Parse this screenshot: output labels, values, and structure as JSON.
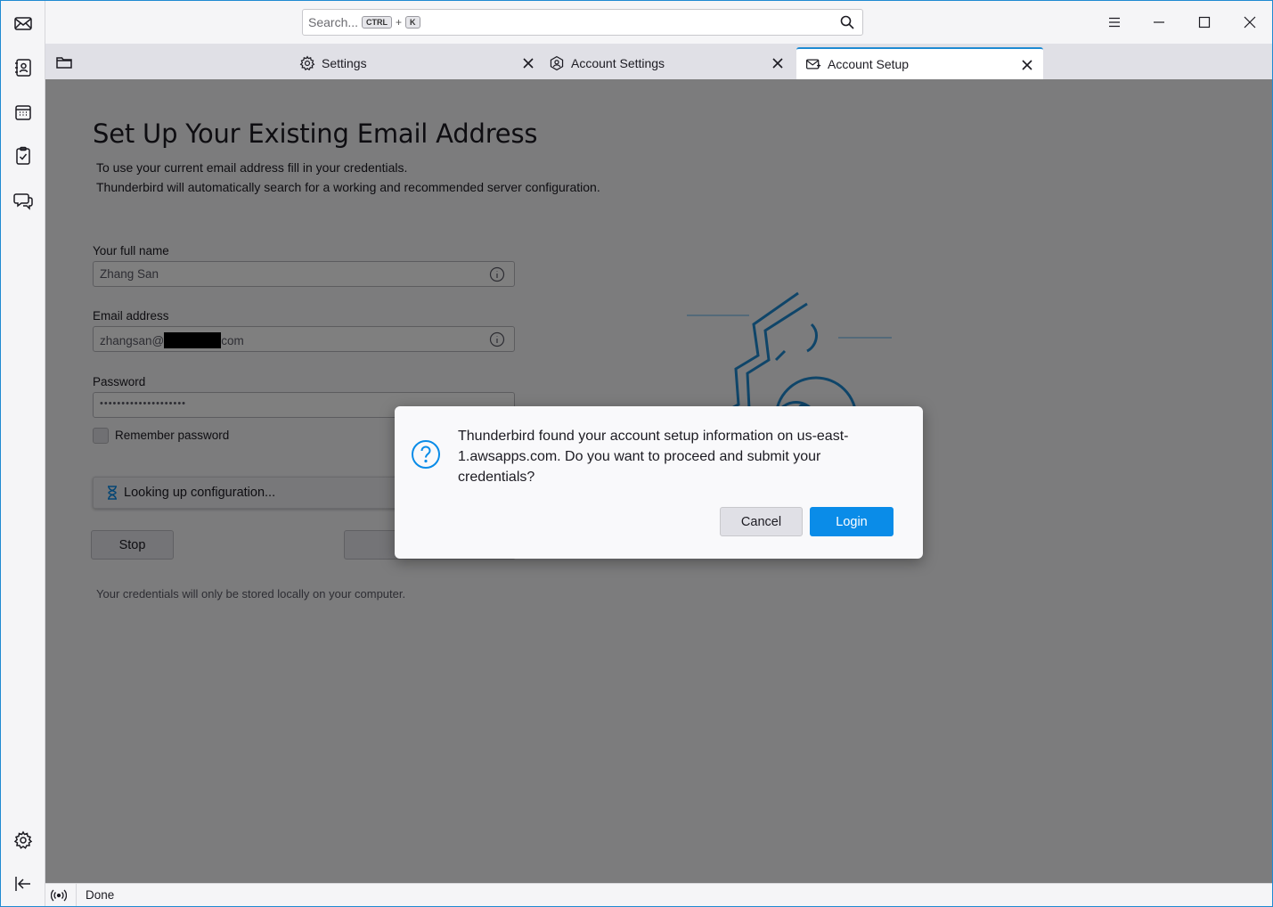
{
  "search": {
    "placeholder": "Search...",
    "key1": "CTRL",
    "plus": "+",
    "key2": "K"
  },
  "tabs": [
    {
      "label": "Settings",
      "icon": "gear-icon"
    },
    {
      "label": "Account Settings",
      "icon": "account-settings-icon"
    },
    {
      "label": "Account Setup",
      "icon": "mail-setup-icon",
      "active": true
    }
  ],
  "page": {
    "title": "Set Up Your Existing Email Address",
    "subtitle1": "To use your current email address fill in your credentials.",
    "subtitle2": "Thunderbird will automatically search for a working and recommended server configuration.",
    "name_label": "Your full name",
    "name_value": "Zhang San",
    "email_label": "Email address",
    "email_prefix": "zhangsan@",
    "email_suffix": "com",
    "password_label": "Password",
    "password_value": "••••••••••••••••••••",
    "remember_label": "Remember password",
    "status_text": "Looking up configuration...",
    "stop_label": "Stop",
    "cancel_label": "Cancel",
    "note": "Your credentials will only be stored locally on your computer."
  },
  "dialog": {
    "message": "Thunderbird found your account setup information on us-east-1.awsapps.com. Do you want to proceed and submit your credentials?",
    "cancel_label": "Cancel",
    "login_label": "Login"
  },
  "statusbar": {
    "text": "Done"
  },
  "colors": {
    "accent": "#0a8ce8",
    "window_border": "#1f8ad2"
  }
}
